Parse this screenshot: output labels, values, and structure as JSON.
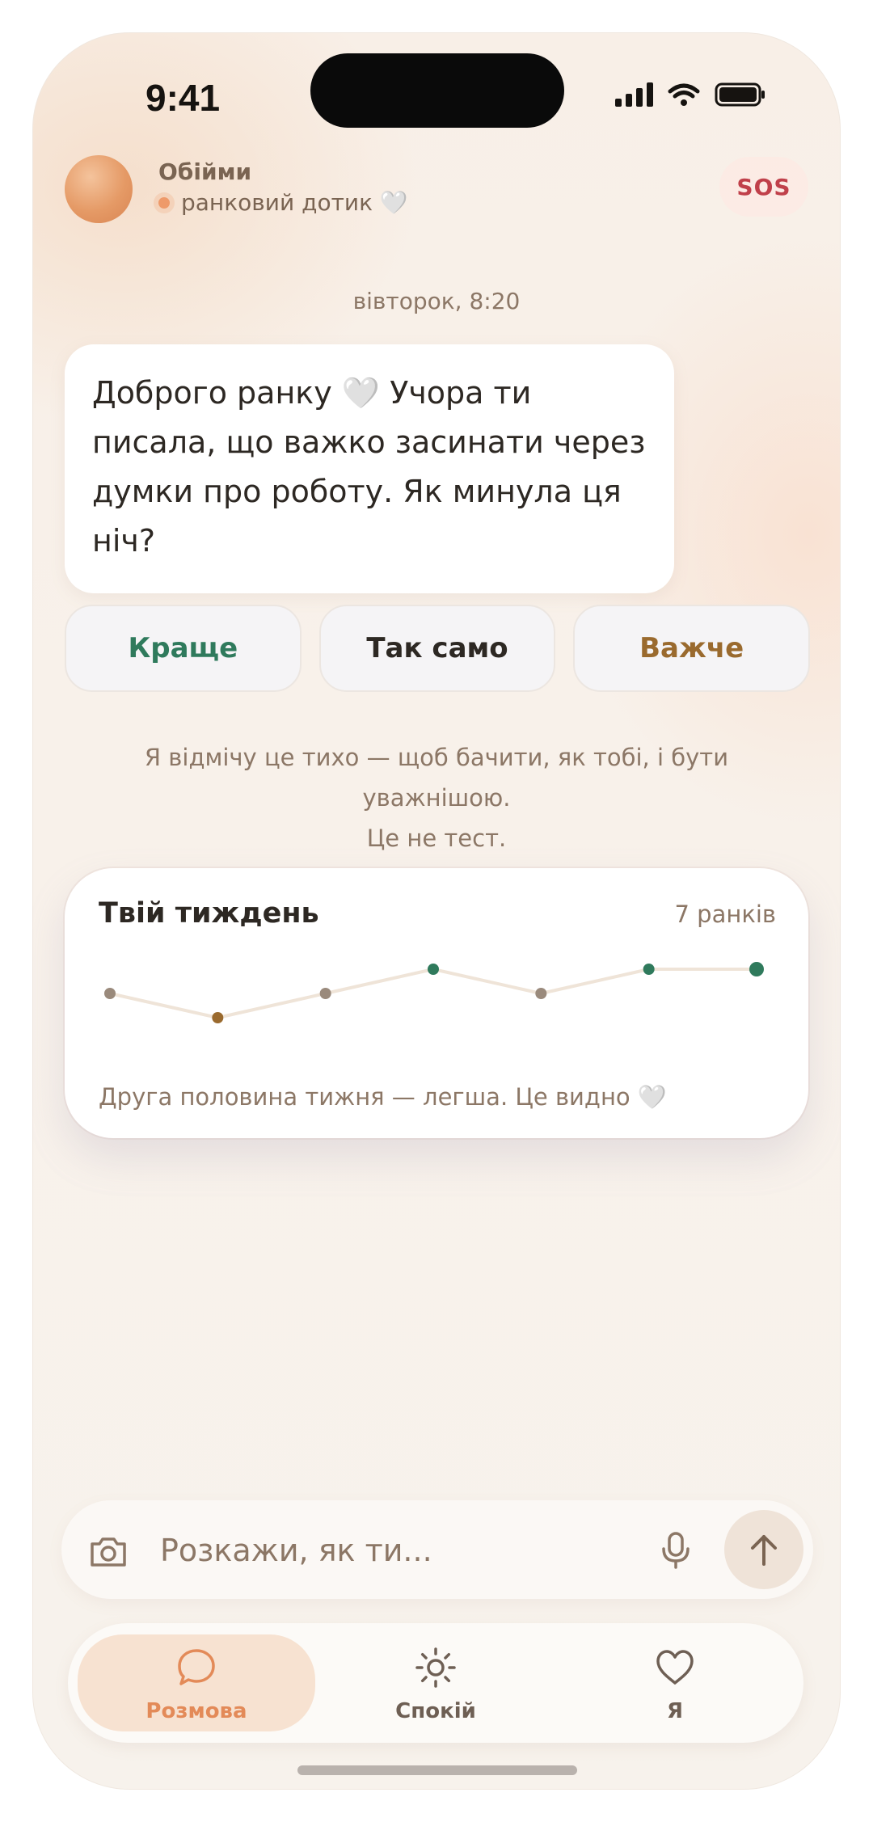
{
  "status_bar": {
    "time": "9:41"
  },
  "header": {
    "app_name": "Обійми",
    "subtitle": "ранковий дотик 🤍",
    "sos_label": "SOS"
  },
  "chat": {
    "timestamp": "вівторок, 8:20",
    "message": "Доброго ранку 🤍 Учора ти писала, що важко засинати через думки про роботу. Як минула ця ніч?"
  },
  "quick_replies": [
    {
      "label": "Краще",
      "color": "#2f7a5c"
    },
    {
      "label": "Так само",
      "color": "#2d2823"
    },
    {
      "label": "Важче",
      "color": "#9a6a2e"
    }
  ],
  "note": {
    "line1": "Я відмічу це тихо — щоб бачити, як тобі, і бути уважнішою.",
    "line2": "Це не тест."
  },
  "week_card": {
    "title": "Твій тиждень",
    "count": "7 ранків",
    "caption": "Друга половина тижня — легша. Це видно 🤍",
    "chart_data": {
      "type": "line",
      "series": [
        {
          "values": [
            0,
            -1,
            0,
            1,
            0,
            1,
            1
          ]
        }
      ],
      "point_colors": [
        "#9a8a7c",
        "#9a6a2e",
        "#9a8a7c",
        "#2f7a5c",
        "#9a8a7c",
        "#2f7a5c",
        "#2f7a5c"
      ],
      "line_color": "#efe4d8",
      "ylim": [
        -1,
        1
      ],
      "grid": false
    }
  },
  "composer": {
    "placeholder": "Розкажи, як ти...",
    "value": ""
  },
  "tabs": [
    {
      "label": "Розмова",
      "icon": "chat-bubble-icon",
      "active": true
    },
    {
      "label": "Спокій",
      "icon": "sun-icon",
      "active": false
    },
    {
      "label": "Я",
      "icon": "heart-icon",
      "active": false
    }
  ],
  "colors": {
    "accent": "#e38a58",
    "sos": "#c0404a",
    "better": "#2f7a5c",
    "worse": "#9a6a2e",
    "text_muted": "#8c7766"
  }
}
